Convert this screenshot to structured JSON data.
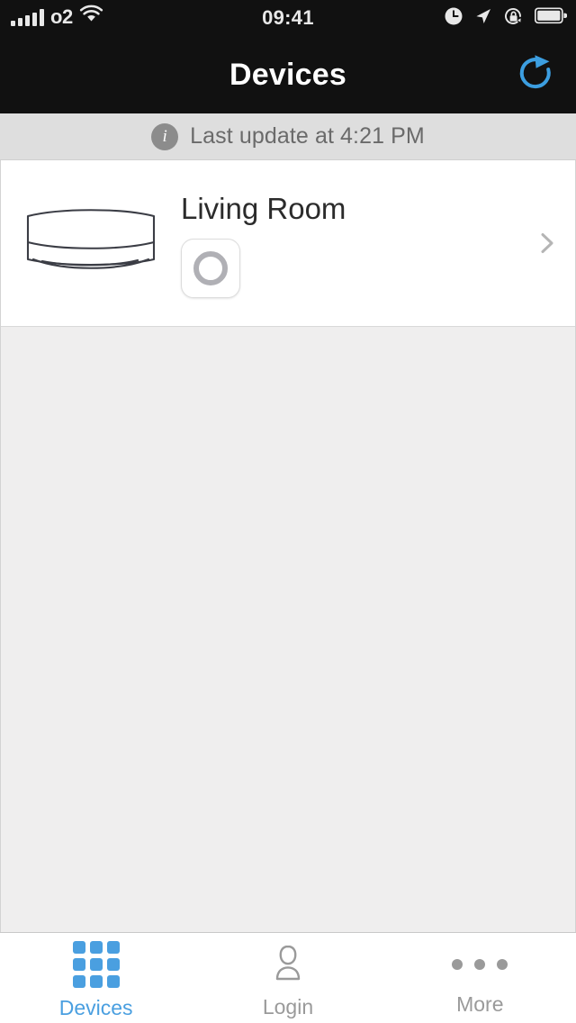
{
  "status_bar": {
    "carrier": "o2",
    "signal_bars_total": 5,
    "signal_bars_filled": 5,
    "wifi_icon": "wifi-icon",
    "time": "09:41",
    "icons": [
      "alarm-clock-icon",
      "location-arrow-icon",
      "rotation-lock-icon",
      "battery-full-icon"
    ]
  },
  "nav_bar": {
    "title": "Devices",
    "refresh_icon": "refresh-icon",
    "refresh_color": "#3c9ee0",
    "background": "#111111"
  },
  "banner": {
    "info_icon": "info-icon",
    "info_glyph": "i",
    "text": "Last update at 4:21 PM",
    "background": "#dedede"
  },
  "devices": [
    {
      "name": "Living Room",
      "thumbnail_icon": "air-conditioner-icon",
      "power_state": "off",
      "power_icon": "power-ring-icon",
      "disclosure_icon": "chevron-right-icon"
    }
  ],
  "tab_bar": {
    "active_color": "#4a9fe0",
    "inactive_color": "#9a9a9a",
    "tabs": [
      {
        "label": "Devices",
        "icon": "grid-icon",
        "active": true
      },
      {
        "label": "Login",
        "icon": "person-icon",
        "active": false
      },
      {
        "label": "More",
        "icon": "ellipsis-icon",
        "active": false
      }
    ]
  }
}
